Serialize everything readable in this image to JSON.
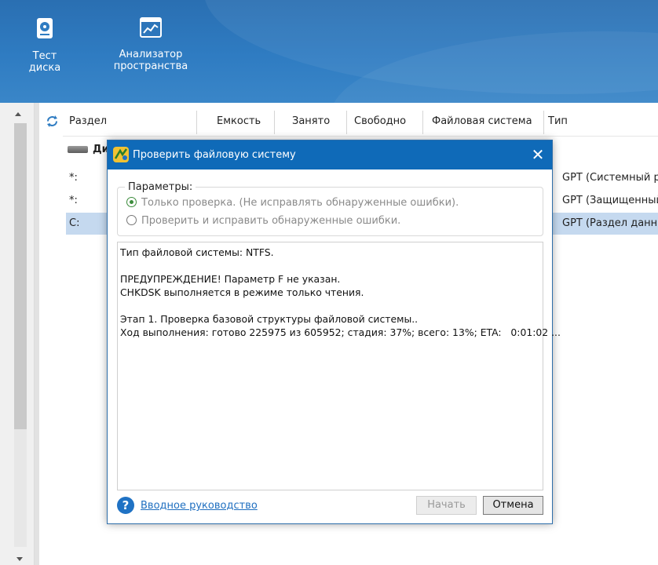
{
  "toolbar": {
    "disk_test_label": "Тест диска",
    "space_analyzer_label": "Анализатор пространства"
  },
  "table": {
    "columns": [
      "Раздел",
      "Емкость",
      "Занято",
      "Свободно",
      "Файловая система",
      "Тип"
    ],
    "disk_label": "Ди",
    "rows": [
      {
        "partition": "*:",
        "type": "GPT (Системный раз"
      },
      {
        "partition": "*:",
        "type": "GPT (Защищенный р"
      },
      {
        "partition": "C:",
        "type": "GPT (Раздел данных)"
      }
    ],
    "selected_row": 2
  },
  "dialog": {
    "title": "Проверить файловую систему",
    "params_legend": "Параметры:",
    "option1": "Только проверка. (Не исправлять обнаруженные ошибки).",
    "option2": "Проверить и исправить обнаруженные ошибки.",
    "selected_option": 1,
    "log_lines": [
      "Тип файловой системы: NTFS.",
      "",
      "ПРЕДУПРЕЖДЕНИЕ! Параметр F не указан.",
      "CHKDSK выполняется в режиме только чтения.",
      "",
      "Этап 1. Проверка базовой структуры файловой системы..",
      "Ход выполнения: готово 225975 из 605952; стадия: 37%; всего: 13%; ETA:   0:01:02 ..."
    ],
    "help_link": "Вводное руководство",
    "start_button": "Начать",
    "cancel_button": "Отмена"
  },
  "colors": {
    "ribbon": "#2f7cc2",
    "dialog_title": "#0f6ab8",
    "selected_row": "#c5d9ef",
    "link": "#1f6fc0"
  }
}
